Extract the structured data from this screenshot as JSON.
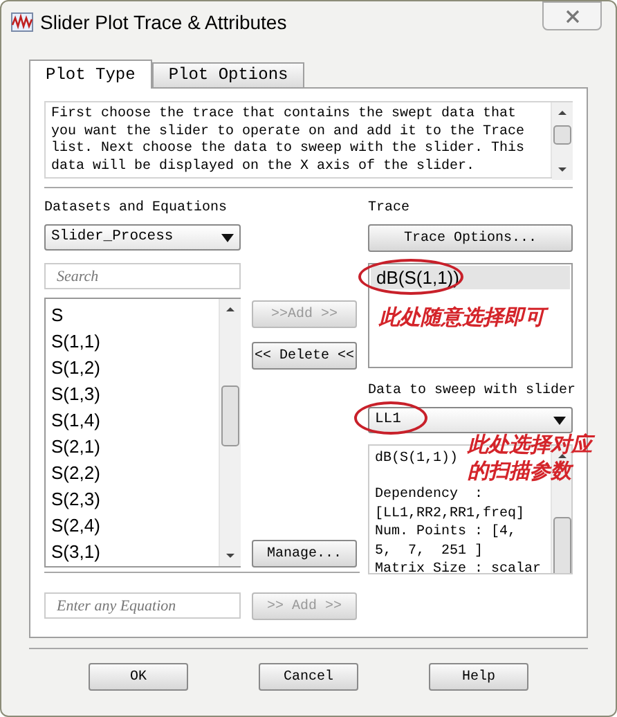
{
  "window": {
    "title": "Slider Plot Trace & Attributes"
  },
  "tabs": [
    {
      "label": "Plot Type",
      "selected": true
    },
    {
      "label": "Plot Options",
      "selected": false
    }
  ],
  "description": [
    "First choose the trace that contains the swept data that",
    "you want the slider to operate on and add it to the Trace",
    "list. Next choose the data to sweep with the slider. This",
    "data will be displayed on the X axis of the slider."
  ],
  "datasets": {
    "label": "Datasets and Equations",
    "dropdown": "Slider_Process",
    "search": {
      "placeholder": "Search"
    },
    "items": [
      {
        "label": "S",
        "selected": false
      },
      {
        "label": "S(1,1)",
        "selected": false
      },
      {
        "label": "S(1,2)",
        "selected": false
      },
      {
        "label": "S(1,3)",
        "selected": false
      },
      {
        "label": "S(1,4)",
        "selected": false
      },
      {
        "label": "S(2,1)",
        "selected": false
      },
      {
        "label": "S(2,2)",
        "selected": false
      },
      {
        "label": "S(2,3)",
        "selected": false
      },
      {
        "label": "S(2,4)",
        "selected": false
      },
      {
        "label": "S(3,1)",
        "selected": false
      }
    ]
  },
  "add_button": {
    "label": ">>Add >>",
    "disabled": true
  },
  "delete_button": {
    "label": "<< Delete <<",
    "disabled": false
  },
  "manage_button": {
    "label": "Manage...",
    "disabled": false
  },
  "equation": {
    "placeholder": "Enter any Equation",
    "add_button": {
      "label": ">> Add >>",
      "disabled": true
    }
  },
  "trace": {
    "label": "Trace",
    "options_button": "Trace Options...",
    "items": [
      {
        "label": "dB(S(1,1))",
        "selected": true
      }
    ]
  },
  "sweep": {
    "label": "Data to sweep with slider",
    "value": "LL1",
    "info_title": "dB(S(1,1))",
    "info": [
      "Dependency  :",
      "[LL1,RR2,RR1,freq]",
      "Num. Points : [4,",
      "5,  7,  251 ]",
      "Matrix Size : scalar"
    ]
  },
  "annotations": [
    {
      "lines": [
        "此处随意选择即可"
      ]
    },
    {
      "lines": [
        "此处选择对应",
        "的扫描参数"
      ]
    }
  ],
  "buttons": [
    "OK",
    "Cancel",
    "Help"
  ]
}
